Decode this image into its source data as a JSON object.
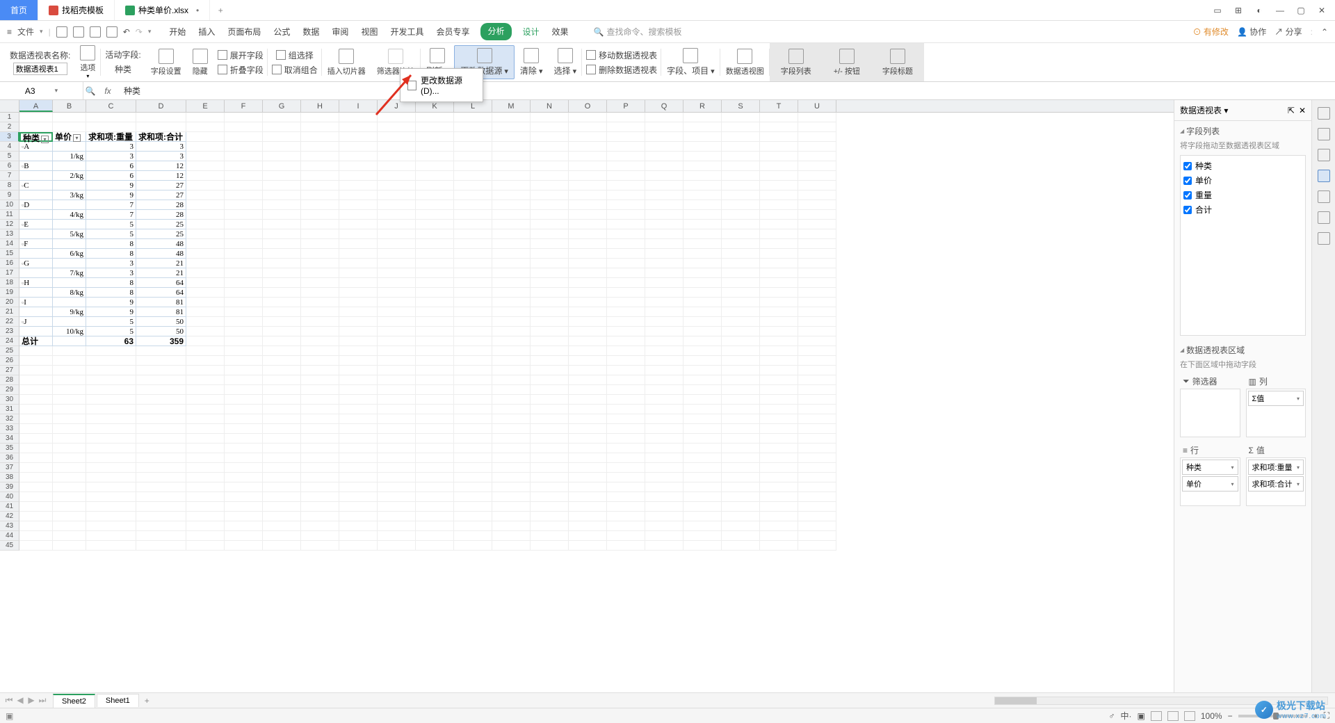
{
  "tabs": {
    "home": "首页",
    "template": "找稻壳模板",
    "file": "种类单价.xlsx",
    "add": "+"
  },
  "winicons": [
    "▭",
    "⊞",
    "◐",
    "—",
    "□",
    "✕"
  ],
  "menubar": {
    "file": "文件",
    "tabs": [
      "开始",
      "插入",
      "页面布局",
      "公式",
      "数据",
      "审阅",
      "视图",
      "开发工具",
      "会员专享",
      "分析",
      "设计",
      "效果"
    ],
    "search": "查找命令、搜索模板",
    "right": {
      "mod": "有修改",
      "coop": "协作",
      "share": "分享"
    }
  },
  "ribbon": {
    "pivotname_label": "数据透视表名称:",
    "pivotname_value": "数据透视表1",
    "options": "选项",
    "activefield_label": "活动字段:",
    "activefield_value": "种类",
    "fieldset": "字段设置",
    "hide": "隐藏",
    "expand": "展开字段",
    "collapse": "折叠字段",
    "groupsel": "组选择",
    "ungroup": "取消组合",
    "slicer": "插入切片器",
    "filterconn": "筛选器连接",
    "refresh": "刷新",
    "changesrc": "更改数据源",
    "clear": "清除",
    "select": "选择",
    "movepivot": "移动数据透视表",
    "delpivot": "删除数据透视表",
    "fields": "字段、项目",
    "pivotchart": "数据透视图",
    "fieldlist": "字段列表",
    "pmbtn": "+/- 按钮",
    "fieldhdr": "字段标题",
    "dropdown": "更改数据源(D)..."
  },
  "formula": {
    "cellref": "A3",
    "fx": "fx",
    "value": "种类"
  },
  "cols": [
    "A",
    "B",
    "C",
    "D",
    "E",
    "F",
    "G",
    "H",
    "I",
    "J",
    "K",
    "L",
    "M",
    "N",
    "O",
    "P",
    "Q",
    "R",
    "S",
    "T",
    "U"
  ],
  "colwidths": {
    "A": 48,
    "B": 48,
    "C": 72,
    "D": 72
  },
  "pivot": {
    "headers": [
      "种类",
      "单价",
      "求和项:重量",
      "求和项:合计"
    ],
    "rows": [
      {
        "r": 3,
        "type": "hdr"
      },
      {
        "r": 4,
        "cat": "A"
      },
      {
        "r": 5,
        "price": "1/kg",
        "w": "3",
        "t": "3"
      },
      {
        "r": 6,
        "cat": "B",
        "w": "6",
        "t": "12"
      },
      {
        "r": 7,
        "price": "2/kg",
        "w": "6",
        "t": "12"
      },
      {
        "r": 8,
        "cat": "C",
        "w": "9",
        "t": "27"
      },
      {
        "r": 9,
        "price": "3/kg",
        "w": "9",
        "t": "27"
      },
      {
        "r": 10,
        "cat": "D",
        "w": "7",
        "t": "28"
      },
      {
        "r": 11,
        "price": "4/kg",
        "w": "7",
        "t": "28"
      },
      {
        "r": 12,
        "cat": "E",
        "w": "5",
        "t": "25"
      },
      {
        "r": 13,
        "price": "5/kg",
        "w": "5",
        "t": "25"
      },
      {
        "r": 14,
        "cat": "F",
        "w": "8",
        "t": "48"
      },
      {
        "r": 15,
        "price": "6/kg",
        "w": "8",
        "t": "48"
      },
      {
        "r": 16,
        "cat": "G",
        "w": "3",
        "t": "21"
      },
      {
        "r": 17,
        "price": "7/kg",
        "w": "3",
        "t": "21"
      },
      {
        "r": 18,
        "cat": "H",
        "w": "8",
        "t": "64"
      },
      {
        "r": 19,
        "price": "8/kg",
        "w": "8",
        "t": "64"
      },
      {
        "r": 20,
        "cat": "I",
        "w": "9",
        "t": "81"
      },
      {
        "r": 21,
        "price": "9/kg",
        "w": "9",
        "t": "81"
      },
      {
        "r": 22,
        "cat": "J",
        "w": "5",
        "t": "50"
      },
      {
        "r": 23,
        "price": "10/kg",
        "w": "5",
        "t": "50"
      },
      {
        "r": 24,
        "total": "总计",
        "w": "63",
        "t": "359"
      }
    ],
    "row4extra": {
      "w": "3",
      "t": "3"
    }
  },
  "sidebar": {
    "title": "数据透视表",
    "fieldlist_title": "字段列表",
    "fieldhint": "将字段拖动至数据透视表区域",
    "fields": [
      "种类",
      "单价",
      "重量",
      "合计"
    ],
    "area_title": "数据透视表区域",
    "area_hint": "在下面区域中拖动字段",
    "filter": "筛选器",
    "col": "列",
    "row": "行",
    "val": "值",
    "col_items": [
      "Σ值"
    ],
    "row_items": [
      "种类",
      "单价"
    ],
    "val_items": [
      "求和项:重量",
      "求和项:合计"
    ]
  },
  "sheets": {
    "s1": "Sheet2",
    "s2": "Sheet1"
  },
  "status": {
    "zoom": "100%"
  },
  "watermark": {
    "name": "极光下载站",
    "url": "www.xz7.com"
  }
}
